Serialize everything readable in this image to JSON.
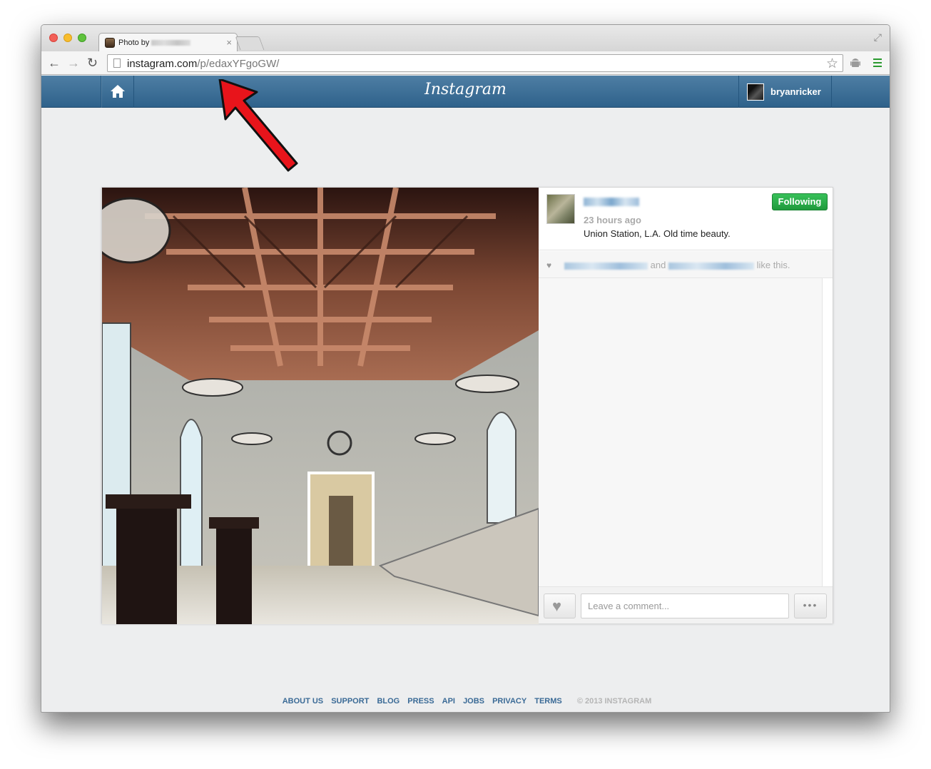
{
  "browser": {
    "tab_title": "Photo by",
    "tab_close": "×",
    "url_host": "instagram.com",
    "url_path": "/p/edaxYFgoGW/"
  },
  "header": {
    "logo": "Instagram",
    "username": "bryanricker"
  },
  "post": {
    "time": "23 hours ago",
    "caption": "Union Station, L.A. Old time beauty.",
    "follow_label": "Following",
    "likes_and": "and",
    "likes_suffix": "like this.",
    "comment_placeholder": "Leave a comment..."
  },
  "footer": {
    "links": [
      "ABOUT US",
      "SUPPORT",
      "BLOG",
      "PRESS",
      "API",
      "JOBS",
      "PRIVACY",
      "TERMS"
    ],
    "copyright": "© 2013 INSTAGRAM"
  },
  "colors": {
    "header_blue": "#2f628b",
    "follow_green": "#1f9a3c",
    "arrow_red": "#e8141b",
    "footer_link": "#3a6a96"
  },
  "icons": [
    "home-icon",
    "heart-icon",
    "star-icon",
    "more-icon",
    "reload-icon",
    "back-icon",
    "forward-icon"
  ]
}
